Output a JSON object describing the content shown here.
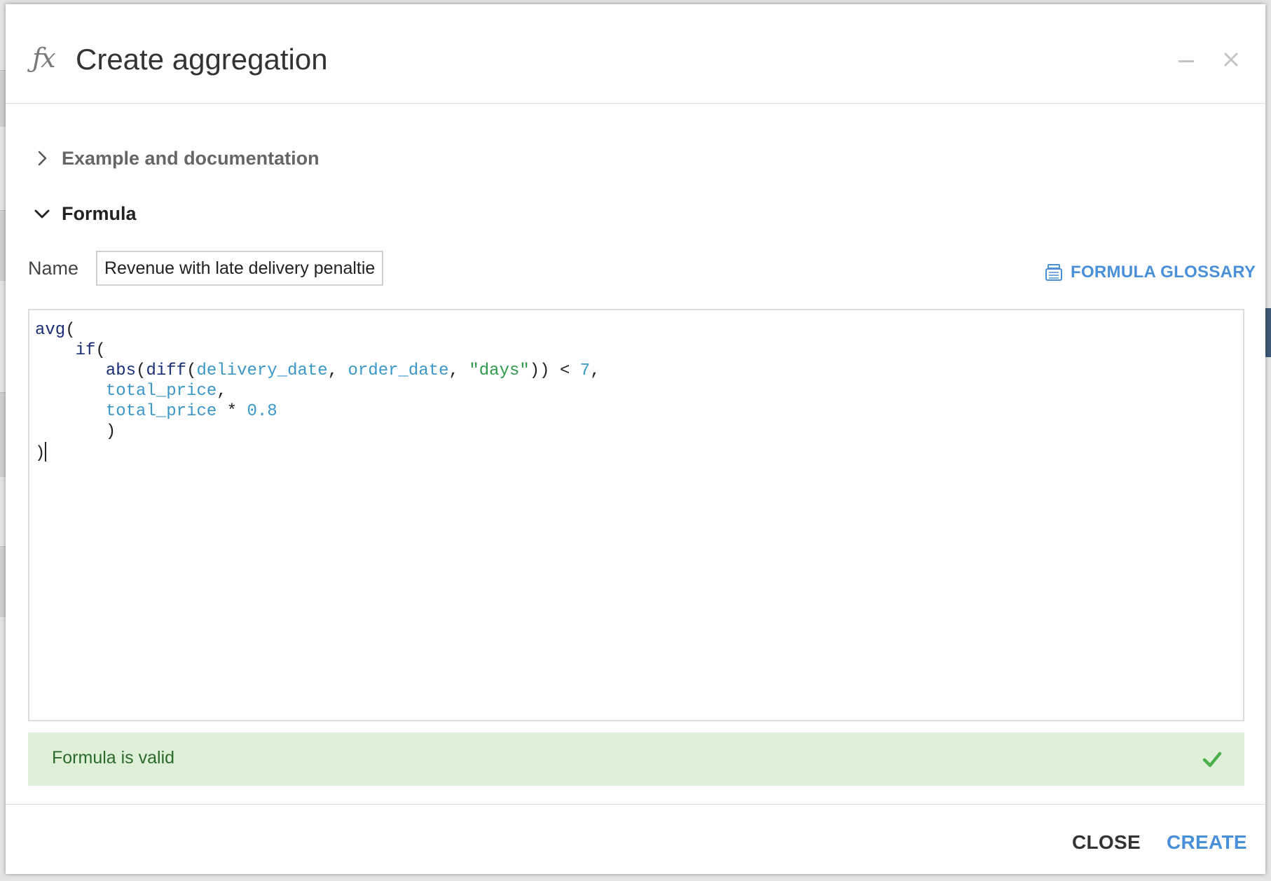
{
  "dialog": {
    "title": "Create aggregation",
    "icon": "function-icon"
  },
  "sections": {
    "documentation_label": "Example and documentation",
    "formula_label": "Formula"
  },
  "name_field": {
    "label": "Name",
    "value": "Revenue with late delivery penalties"
  },
  "glossary": {
    "label": "FORMULA GLOSSARY"
  },
  "formula": {
    "lines": [
      [
        {
          "t": "avg",
          "c": "fn"
        },
        {
          "t": "(",
          "c": "op"
        }
      ],
      [
        {
          "t": "    ",
          "c": "op"
        },
        {
          "t": "if",
          "c": "fn"
        },
        {
          "t": "(",
          "c": "op"
        }
      ],
      [
        {
          "t": "       ",
          "c": "op"
        },
        {
          "t": "abs",
          "c": "fn"
        },
        {
          "t": "(",
          "c": "op"
        },
        {
          "t": "diff",
          "c": "fn"
        },
        {
          "t": "(",
          "c": "op"
        },
        {
          "t": "delivery_date",
          "c": "field"
        },
        {
          "t": ", ",
          "c": "op"
        },
        {
          "t": "order_date",
          "c": "field"
        },
        {
          "t": ", ",
          "c": "op"
        },
        {
          "t": "\"days\"",
          "c": "str"
        },
        {
          "t": ")) < ",
          "c": "op"
        },
        {
          "t": "7",
          "c": "num"
        },
        {
          "t": ",",
          "c": "op"
        }
      ],
      [
        {
          "t": "       ",
          "c": "op"
        },
        {
          "t": "total_price",
          "c": "field"
        },
        {
          "t": ",",
          "c": "op"
        }
      ],
      [
        {
          "t": "       ",
          "c": "op"
        },
        {
          "t": "total_price",
          "c": "field"
        },
        {
          "t": " * ",
          "c": "op"
        },
        {
          "t": "0.8",
          "c": "num"
        }
      ],
      [
        {
          "t": "       )",
          "c": "op"
        }
      ],
      [
        {
          "t": ")",
          "c": "op"
        }
      ]
    ]
  },
  "validation": {
    "message": "Formula is valid",
    "status": "valid",
    "color": "#dff0d8"
  },
  "footer": {
    "close_label": "CLOSE",
    "create_label": "CREATE"
  },
  "colors": {
    "accent": "#4a90d9",
    "success": "#4cae4c"
  }
}
